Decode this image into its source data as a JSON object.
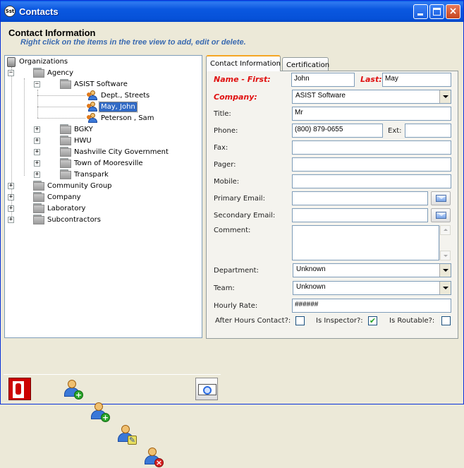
{
  "window": {
    "title": "Contacts",
    "icon_text": "Sst",
    "buttons": {
      "minimize": "minimize-button",
      "maximize": "maximize-button",
      "close": "×"
    }
  },
  "header": {
    "title": "Contact Information",
    "subtitle": "Right click on the items in the tree view to add, edit or delete."
  },
  "tree": {
    "root": "Organizations",
    "agency": "Agency",
    "asist": "ASIST Software",
    "contacts": [
      "Dept., Streets",
      "May, John",
      "Peterson , Sam"
    ],
    "agency_children": [
      "BGKY",
      "HWU",
      "Nashville City Government",
      "Town of Mooresville",
      "Transpark"
    ],
    "top_groups": [
      "Community Group",
      "Company",
      "Laboratory",
      "Subcontractors"
    ],
    "selected": "May, John"
  },
  "tabs": [
    {
      "label": "Contact Information",
      "active": true
    },
    {
      "label": "Certification",
      "active": false
    }
  ],
  "form": {
    "name_first_label": "Name - First:",
    "first_value": "John",
    "last_label": "Last:",
    "last_value": "May",
    "company_label": "Company:",
    "company_value": "ASIST Software",
    "title_label": "Title:",
    "title_value": "Mr",
    "phone_label": "Phone:",
    "phone_value": "(800) 879-0655",
    "ext_label": "Ext:",
    "ext_value": "",
    "fax_label": "Fax:",
    "fax_value": "",
    "pager_label": "Pager:",
    "pager_value": "",
    "mobile_label": "Mobile:",
    "mobile_value": "",
    "primary_email_label": "Primary Email:",
    "primary_email_value": "",
    "secondary_email_label": "Secondary Email:",
    "secondary_email_value": "",
    "comment_label": "Comment:",
    "comment_value": "",
    "department_label": "Department:",
    "department_value": "Unknown",
    "team_label": "Team:",
    "team_value": "Unknown",
    "hourly_rate_label": "Hourly Rate:",
    "hourly_rate_value": "######",
    "after_hours_label": "After Hours Contact?:",
    "after_hours_checked": false,
    "inspector_label": "Is Inspector?:",
    "inspector_checked": true,
    "routable_label": "Is Routable?:",
    "routable_checked": false,
    "check_mark": "✔"
  },
  "toolbar": {
    "icons": [
      "exit-icon",
      "add-contact-icon",
      "add-user-icon",
      "edit-user-icon",
      "delete-user-icon",
      "search-icon"
    ],
    "plus": "+",
    "minus": "×"
  },
  "colors": {
    "titlebar": "#0a58e0",
    "required_label": "#e01010",
    "subtitle": "#3a6ab0",
    "selection": "#316ac5"
  }
}
